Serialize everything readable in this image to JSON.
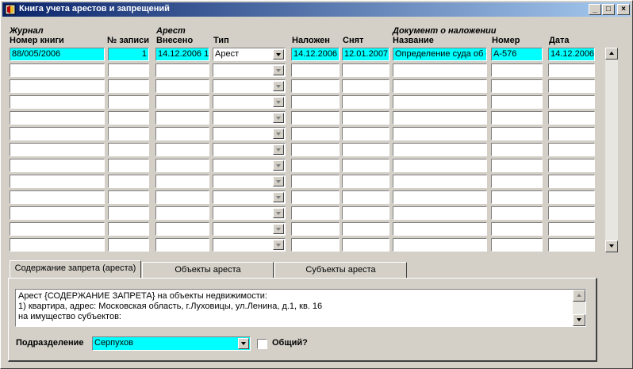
{
  "window": {
    "title": "Книга учета арестов и запрещений",
    "minimize": "_",
    "maximize": "□",
    "close": "×"
  },
  "groups": {
    "journal": "Журнал",
    "arrest": "Арест",
    "document": "Документ о наложении"
  },
  "columns": {
    "book_number": "Номер книги",
    "record_number": "№ записи",
    "entered": "Внесено",
    "type": "Тип",
    "imposed": "Наложен",
    "removed": "Снят",
    "doc_name": "Название",
    "doc_number": "Номер",
    "doc_date": "Дата"
  },
  "rows": [
    {
      "book_number": "88/005/2006",
      "record_number": "1",
      "entered": "14.12.2006 1",
      "type": "Арест",
      "imposed": "14.12.2006",
      "removed": "12.01.2007",
      "doc_name": "Определение суда об о",
      "doc_number": "А-576",
      "doc_date": "14.12.2006"
    }
  ],
  "tabs": [
    "Содержание запрета (ареста)",
    "Объекты ареста",
    "Субъекты ареста"
  ],
  "content": {
    "lines": [
      "Арест {СОДЕРЖАНИЕ ЗАПРЕТА}  на объекты недвижимости:",
      "1) квартира, адрес: Московская область, г.Луховицы, ул.Ленина, д.1, кв. 16",
      "на имущество субъектов:"
    ]
  },
  "division": {
    "label": "Подразделение",
    "value": "Серпухов"
  },
  "common": {
    "label": "Общий?",
    "checked": false
  },
  "colors": {
    "selection": "#00ffff",
    "title_start": "#0a246a",
    "title_end": "#a6caf0"
  }
}
